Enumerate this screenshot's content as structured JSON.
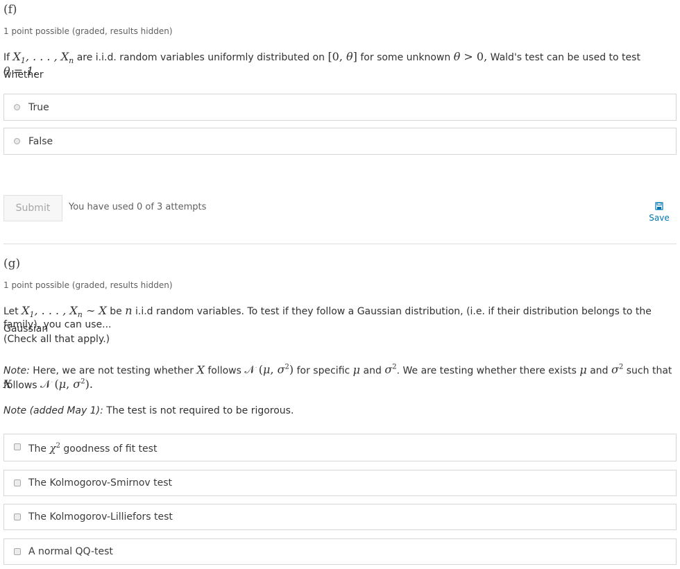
{
  "problem_f": {
    "label": "(f)",
    "points": "1 point possible (graded, results hidden)",
    "q_if": "If",
    "q_are": " are i.i.d. random variables uniformly distributed on ",
    "q_some": " for some unknown ",
    "q_wald": " Wald's test can be used to test whether",
    "q_theta1": "θ = 1.",
    "options": [
      "True",
      "False"
    ],
    "submit_label": "Submit",
    "attempts_text": "You have used 0 of 3 attempts",
    "save_label": "Save"
  },
  "problem_g": {
    "label": "(g)",
    "points": "1 point possible (graded, results hidden)",
    "q_let": "Let",
    "q_be": " be ",
    "q_rest1": " i.i.d random variables. To test if they follow a Gaussian distribution, (i.e. if their distribution belongs to the Gaussian",
    "q_rest2": "family), you can use...",
    "q_rest3": "(Check all that apply.)",
    "note_label": "Note:",
    "note_a": " Here, we are not testing whether ",
    "note_b": " follows ",
    "note_c": " for specific ",
    "note_d": " and ",
    "note_e": ". We are testing whether there exists ",
    "note_f": " and ",
    "note_g": " such that ",
    "note_h": "follows ",
    "note2_label": "Note (added May 1):",
    "note2_text": " The test is not required to be rigorous.",
    "option_chi_pre": "The ",
    "option_chi_post": " goodness of fit test",
    "options": [
      "The Kolmogorov-Smirnov test",
      "The Kolmogorov-Lilliefors test",
      "A normal QQ-test"
    ]
  }
}
